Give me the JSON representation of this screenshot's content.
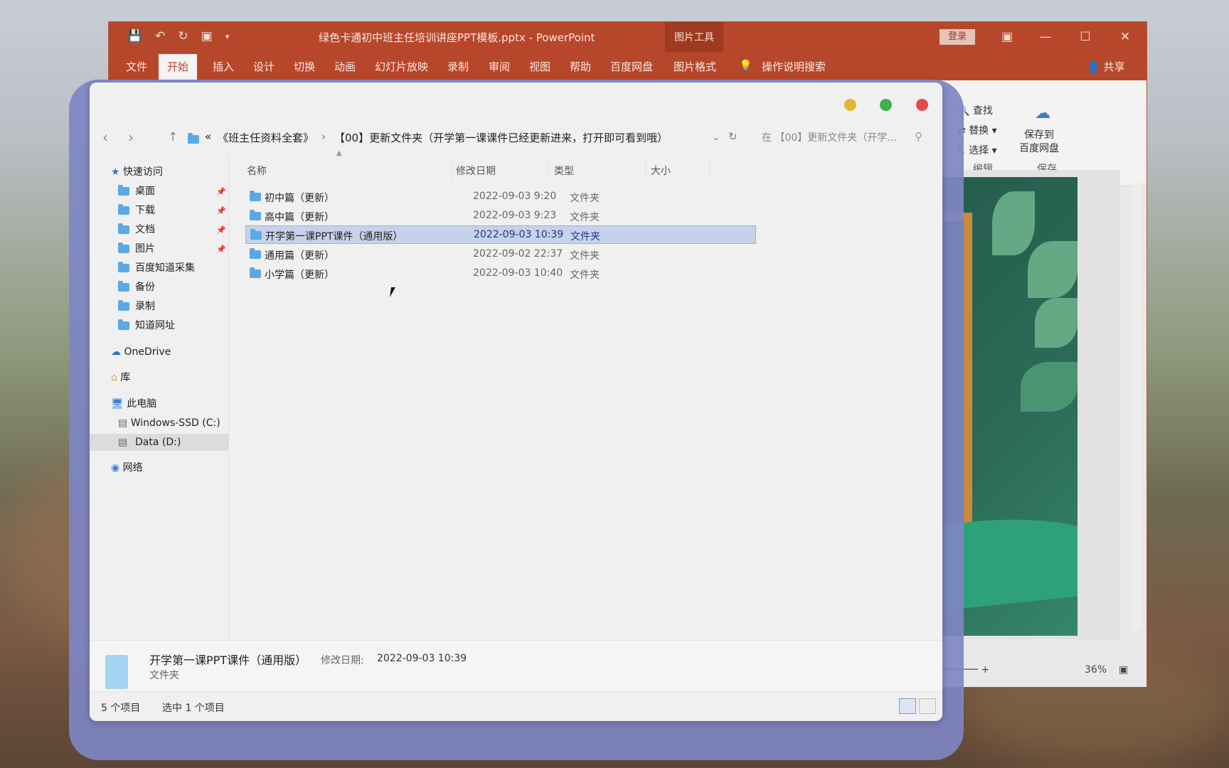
{
  "powerpoint": {
    "title": "绿色卡通初中班主任培训讲座PPT模板.pptx  -  PowerPoint",
    "picture_tools": "图片工具",
    "login": "登录",
    "tabs": [
      "文件",
      "开始",
      "插入",
      "设计",
      "切换",
      "动画",
      "幻灯片放映",
      "录制",
      "审阅",
      "视图",
      "帮助",
      "百度网盘",
      "图片格式"
    ],
    "tell_me": "操作说明搜索",
    "share": "共享",
    "ribbon": {
      "find": "查找",
      "replace": "替换",
      "select": "选择",
      "edit_group": "编辑",
      "save_to": "保存到",
      "baidu_disk": "百度网盘",
      "save_group": "保存"
    },
    "zoom": "36%"
  },
  "explorer": {
    "breadcrumb": {
      "overflow": "«",
      "part1": "《班主任资料全套》",
      "sep": "›",
      "part2": "【00】更新文件夹（开学第一课课件已经更新进来，打开即可看到哦）"
    },
    "search_placeholder": "在 【00】更新文件夹（开学...",
    "sidebar": {
      "quick_access": "快速访问",
      "items": [
        "桌面",
        "下载",
        "文档",
        "图片",
        "百度知道采集",
        "备份",
        "录制",
        "知道网址"
      ],
      "onedrive": "OneDrive",
      "library": "库",
      "this_pc": "此电脑",
      "drive_c": "Windows-SSD (C:)",
      "drive_d": "Data (D:)",
      "network": "网络"
    },
    "columns": {
      "name": "名称",
      "date": "修改日期",
      "type": "类型",
      "size": "大小"
    },
    "files": [
      {
        "name": "初中篇（更新）",
        "date": "2022-09-03 9:20",
        "type": "文件夹"
      },
      {
        "name": "高中篇（更新）",
        "date": "2022-09-03 9:23",
        "type": "文件夹"
      },
      {
        "name": "开学第一课PPT课件（通用版）",
        "date": "2022-09-03 10:39",
        "type": "文件夹"
      },
      {
        "name": "通用篇（更新）",
        "date": "2022-09-02 22:37",
        "type": "文件夹"
      },
      {
        "name": "小学篇（更新）",
        "date": "2022-09-03 10:40",
        "type": "文件夹"
      }
    ],
    "details": {
      "name": "开学第一课PPT课件（通用版）",
      "date_label": "修改日期:",
      "date": "2022-09-03 10:39",
      "type": "文件夹"
    },
    "status": {
      "count": "5 个项目",
      "selected": "选中 1 个项目"
    }
  },
  "colors": {
    "ppt_accent": "#b7472a",
    "selection": "#c6d2ea",
    "mac_yellow": "#e3b532",
    "mac_green": "#3db14a",
    "mac_red": "#e14b4b"
  }
}
